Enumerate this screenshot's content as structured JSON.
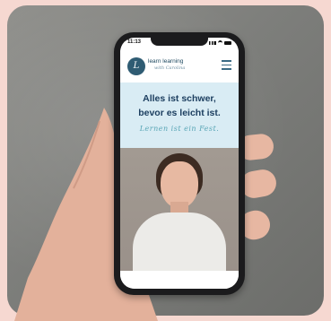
{
  "status_bar": {
    "time": "11:13"
  },
  "site": {
    "logo_text": "L",
    "brand": "learn learning",
    "brand_sub": "with Carolina"
  },
  "hero": {
    "line1": "Alles ist schwer,",
    "line2": "bevor es leicht ist.",
    "script": "Lernen ist ein Fest."
  },
  "colors": {
    "background": "#f6d8d1",
    "hero_bg": "#d9ecf4",
    "heading": "#1d3f60",
    "script": "#5aa6b6"
  },
  "icons": [
    "menu-icon",
    "signal-icon",
    "wifi-icon",
    "battery-icon"
  ]
}
